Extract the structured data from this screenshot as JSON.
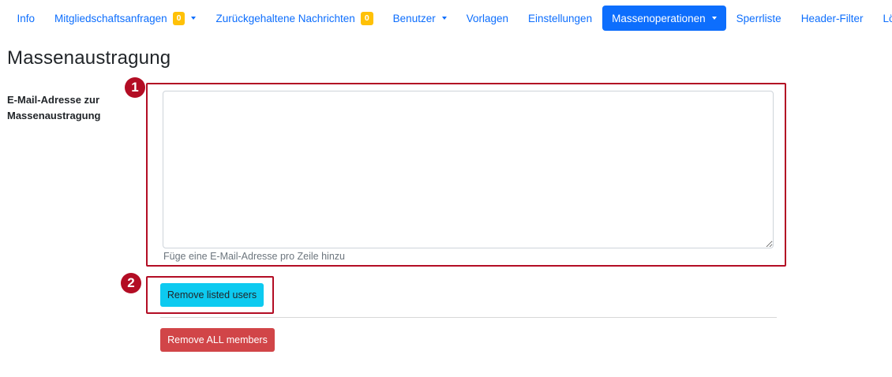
{
  "nav": {
    "info": "Info",
    "membership_requests": "Mitgliedschaftsanfragen",
    "membership_requests_count": "0",
    "held_messages": "Zurückgehaltene Nachrichten",
    "held_messages_count": "0",
    "users": "Benutzer",
    "templates": "Vorlagen",
    "settings": "Einstellungen",
    "mass_operations": "Massenoperationen",
    "ban_list": "Sperrliste",
    "header_filters": "Header-Filter",
    "delete": "Löschen"
  },
  "page": {
    "title": "Massenaustragung",
    "field_label": "E-Mail-Adresse zur Massenaustragung",
    "textarea_value": "",
    "help_text": "Füge eine E-Mail-Adresse pro Zeile hinzu",
    "remove_listed_label": "Remove listed users",
    "remove_all_label": "Remove ALL members"
  },
  "annotations": {
    "marker_1": "1",
    "marker_2": "2"
  },
  "colors": {
    "primary": "#0d6efd",
    "badge": "#ffc107",
    "info_button": "#0dcaf0",
    "danger_button": "#d14548",
    "highlight": "#b30d24"
  }
}
